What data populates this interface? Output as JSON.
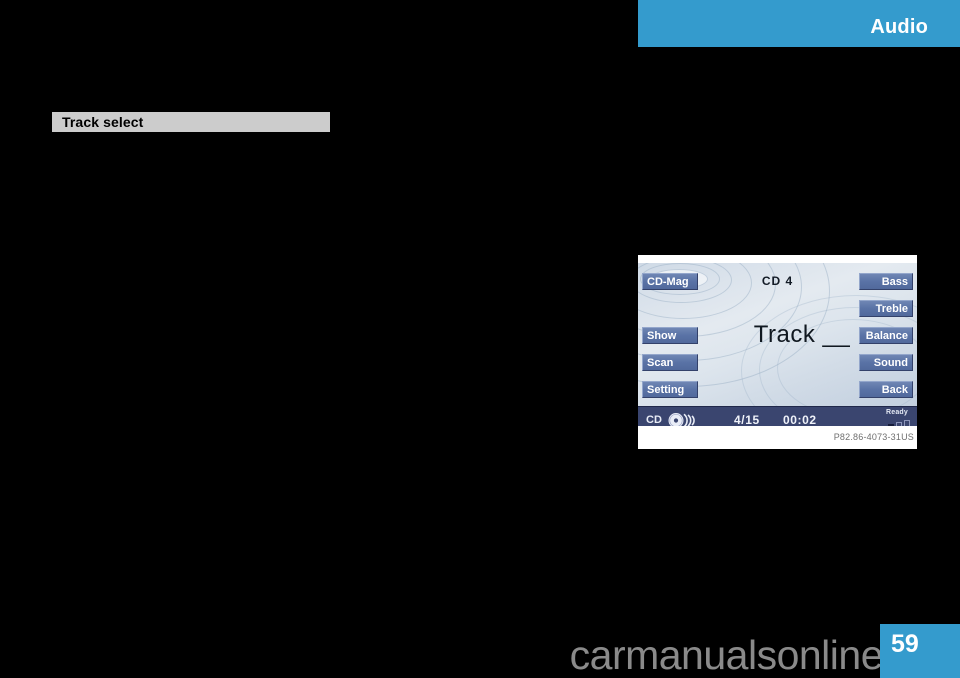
{
  "section_header": {
    "title": "Audio",
    "accent_color": "#349bcd"
  },
  "subsection": {
    "heading": "Track select",
    "background_color": "#cccccc"
  },
  "figure": {
    "caption": "P82.86-4073-31US",
    "head_unit": {
      "title": "CD 4",
      "center_text": "Track __",
      "left_buttons": [
        {
          "label": "CD-Mag"
        },
        {
          "label": "Show"
        },
        {
          "label": "Scan"
        },
        {
          "label": "Setting"
        }
      ],
      "right_buttons": [
        {
          "label": "Bass"
        },
        {
          "label": "Treble"
        },
        {
          "label": "Balance"
        },
        {
          "label": "Sound"
        },
        {
          "label": "Back"
        }
      ],
      "status_bar": {
        "source_label": "CD",
        "source_icon": "cd-disc-icon",
        "track_counter": "4/15",
        "elapsed_time": "00:02",
        "ready_label": "Ready",
        "signal_icon": "signal-bars-icon",
        "background_color": "#3a456f"
      }
    }
  },
  "page_footer": {
    "page_number": "59",
    "badge_color": "#349bcd",
    "watermark": "carmanualsonline.info"
  }
}
